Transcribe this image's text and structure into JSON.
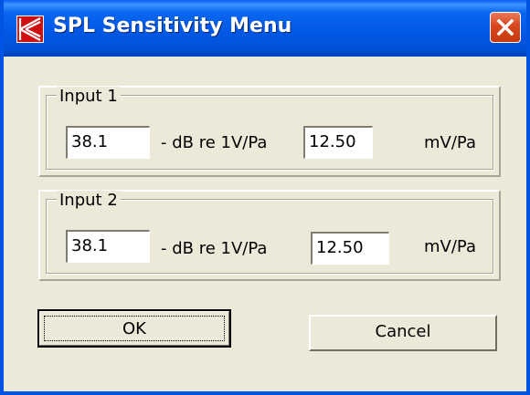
{
  "window": {
    "title": "SPL Sensitivity Menu",
    "app_icon": "k-logo-icon",
    "close_icon": "close-icon",
    "accent": "#0054e3",
    "close_color": "#d8471e"
  },
  "inputs": [
    {
      "legend": "Input 1",
      "db_value": "38.1",
      "db_label": "- dB re 1V/Pa",
      "mv_value": "12.50",
      "mv_label": "mV/Pa"
    },
    {
      "legend": "Input 2",
      "db_value": "38.1",
      "db_label": "- dB re 1V/Pa",
      "mv_value": "12.50",
      "mv_label": "mV/Pa"
    }
  ],
  "buttons": {
    "ok_label": "OK",
    "cancel_label": "Cancel"
  }
}
